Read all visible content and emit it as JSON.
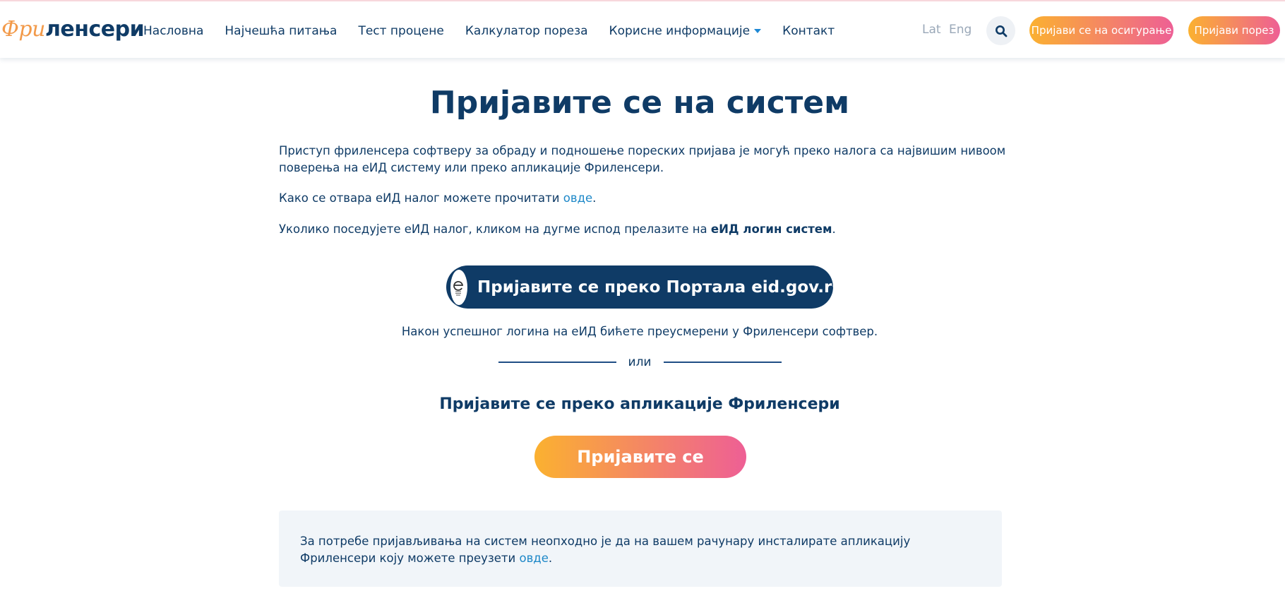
{
  "header": {
    "logo": {
      "part1": "Фри",
      "part2": "ленсери"
    },
    "nav": [
      {
        "label": "Насловна"
      },
      {
        "label": "Најчешћа питања"
      },
      {
        "label": "Тест процене"
      },
      {
        "label": "Калкулатор пореза"
      },
      {
        "label": "Корисне информације",
        "has_dropdown": true
      },
      {
        "label": "Контакт"
      }
    ],
    "lang": {
      "lat": "Lat",
      "eng": "Eng"
    },
    "search_icon": "search-icon",
    "insurance_button": "Пријави се на осигурање",
    "tax_button": "Пријави порез"
  },
  "main": {
    "title": "Пријавите се на систем",
    "intro": "Приступ фриленсера софтверу за обраду и подношење пореских пријава је могућ преко налога са највишим нивоом поверења на еИД систему или преко апликације Фриленсери.",
    "howto": {
      "before": "Како се отвара еИД налог можете прочитати ",
      "link": "овде",
      "after": "."
    },
    "eid_note": {
      "before": "Уколико поседујете еИД налог, кликом на дугме испод прелазите на ",
      "bold": "еИД логин систем",
      "after": "."
    },
    "eid_button": {
      "label": "Пријавите се преко Портала eid.gov.rs",
      "icon": "eid-logo-icon"
    },
    "after_login": "Након успешног логина на еИД бићете преусмерени у Фриленсери софтвер.",
    "or": "или",
    "app_title": "Пријавите се преко апликације Фриленсери",
    "login_button": "Пријавите се",
    "info": {
      "text": "За потребе пријављивања на систем неопходно је да на вашем рачунару инсталирате апликацију Фриленсери коју можете преузети ",
      "link": "овде",
      "after": "."
    }
  },
  "colors": {
    "primary": "#0f3b66",
    "link": "#1e88c8",
    "gradient_start": "#fbb130",
    "gradient_end": "#ee5f95",
    "info_bg": "#f1f5f9"
  }
}
